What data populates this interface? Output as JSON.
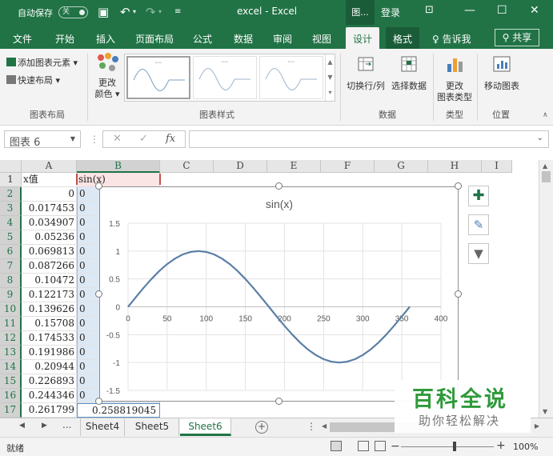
{
  "titlebar": {
    "autosave_label": "自动保存",
    "autosave_state": "关",
    "title": "excel  -  Excel",
    "context_tools": "图...",
    "login": "登录"
  },
  "ribbon_tabs": [
    "文件",
    "开始",
    "插入",
    "页面布局",
    "公式",
    "数据",
    "审阅",
    "视图",
    "设计",
    "格式"
  ],
  "tell_me": "告诉我",
  "share": "共享",
  "ribbon": {
    "add_element": "添加图表元素",
    "quick_layout": "快速布局",
    "change_colors": [
      "更改",
      "颜色"
    ],
    "groups": [
      "图表布局",
      "图表样式",
      "数据",
      "类型",
      "位置"
    ],
    "switch_row_col": "切换行/列",
    "select_data": "选择数据",
    "change_type": [
      "更改",
      "图表类型"
    ],
    "move_chart": "移动图表",
    "thumb_title": "sin(x)",
    "colors": {
      "red": "#e2574c",
      "orange": "#f0a030",
      "blue": "#4a7ebb",
      "green": "#5ea85a",
      "gray": "#9a9a9a"
    }
  },
  "formula_bar": {
    "name_box": "图表 6",
    "fx": "fx",
    "cancel": "✕",
    "enter": "✓",
    "formula": ""
  },
  "grid": {
    "columns": [
      "A",
      "B",
      "C",
      "D",
      "E",
      "F",
      "G",
      "H",
      "I"
    ],
    "rows": [
      "1",
      "2",
      "3",
      "4",
      "5",
      "6",
      "7",
      "8",
      "9",
      "10",
      "11",
      "12",
      "13",
      "14",
      "15",
      "16",
      "17"
    ],
    "a1": "x值",
    "b1": "sin(x)",
    "col_a": [
      "0",
      "0.017453",
      "0.034907",
      "0.05236",
      "0.069813",
      "0.087266",
      "0.10472",
      "0.122173",
      "0.139626",
      "0.15708",
      "0.174533",
      "0.191986",
      "0.20944",
      "0.226893",
      "0.244346",
      "0.261799"
    ],
    "col_b_visible": [
      "0",
      "0",
      "0",
      "0",
      "0",
      "0",
      "0",
      "0",
      "0",
      "0",
      "0",
      "0",
      "0",
      "0",
      "0"
    ],
    "b17": "0.258819045"
  },
  "chart_data": {
    "type": "line",
    "title": "sin(x)",
    "xlabel": "",
    "ylabel": "",
    "x_ticks": [
      0,
      50,
      100,
      150,
      200,
      250,
      300,
      350,
      400
    ],
    "y_ticks": [
      1.5,
      1,
      0.5,
      0,
      -0.5,
      -1,
      -1.5
    ],
    "xlim": [
      0,
      400
    ],
    "ylim": [
      -1.5,
      1.5
    ],
    "grid": true,
    "legend": "none",
    "series": [
      {
        "color": "#5b7fa6",
        "x": [
          0,
          10,
          20,
          30,
          40,
          50,
          60,
          70,
          80,
          90,
          100,
          110,
          120,
          130,
          140,
          150,
          160,
          170,
          180,
          190,
          200,
          210,
          220,
          230,
          240,
          250,
          260,
          270,
          280,
          290,
          300,
          310,
          320,
          330,
          340,
          350,
          360
        ],
        "y": [
          0,
          0.1736,
          0.342,
          0.5,
          0.6428,
          0.766,
          0.866,
          0.9397,
          0.9848,
          1,
          0.9848,
          0.9397,
          0.866,
          0.766,
          0.6428,
          0.5,
          0.342,
          0.1736,
          0,
          -0.1736,
          -0.342,
          -0.5,
          -0.6428,
          -0.766,
          -0.866,
          -0.9397,
          -0.9848,
          -1,
          -0.9848,
          -0.9397,
          -0.866,
          -0.766,
          -0.6428,
          -0.5,
          -0.342,
          -0.1736,
          0
        ]
      }
    ]
  },
  "sheets": {
    "tabs": [
      "Sheet4",
      "Sheet5",
      "Sheet6"
    ],
    "active": "Sheet6",
    "more": "..."
  },
  "status": {
    "text": "就绪",
    "zoom": "100%"
  },
  "watermark": {
    "main": "百科全说",
    "sub": "助你轻松解决"
  }
}
